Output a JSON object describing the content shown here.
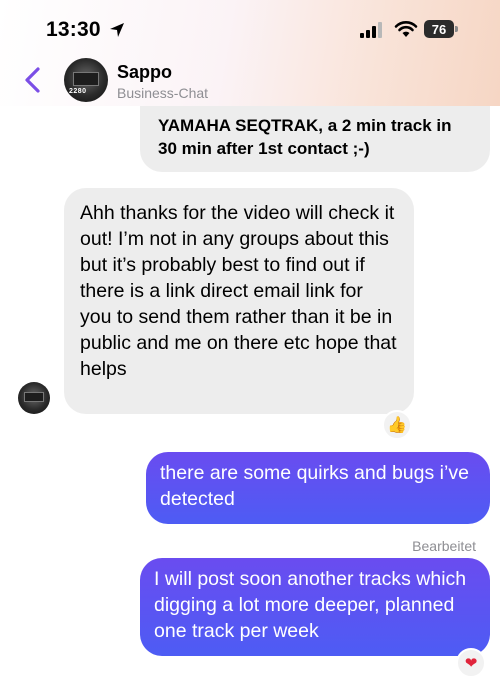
{
  "status_bar": {
    "time": "13:30",
    "battery": "76"
  },
  "header": {
    "contact_name": "Sappo",
    "contact_subtitle": "Business-Chat",
    "avatar_tag": "2280"
  },
  "messages": [
    {
      "direction": "outgoing",
      "text": "YAMAHA SEQTRAK, a 2 min track in 30 min after 1st contact ;-)"
    },
    {
      "direction": "incoming",
      "text": "Ahh thanks for the video will check it out! I’m not in any groups about this but it’s probably best to find out if there is a link direct email link for you to send them rather than it be in public and me on there etc hope that helps",
      "reaction": "👍"
    },
    {
      "direction": "outgoing",
      "text": "there are some quirks and bugs i’ve detected",
      "status": "Bearbeitet"
    },
    {
      "direction": "outgoing",
      "text": "I will post soon another tracks which digging a lot more deeper, planned one track per week",
      "reaction": "❤"
    }
  ],
  "colors": {
    "outgoing_bubble": "#5a55f2",
    "incoming_bubble": "#ededed",
    "accent_back": "#7b4ee6",
    "heart": "#e0243b"
  },
  "icons": [
    "location-arrow-icon",
    "signal-icon",
    "wifi-icon",
    "battery-icon",
    "back-chevron-icon",
    "thumbs-up-icon",
    "heart-icon"
  ]
}
